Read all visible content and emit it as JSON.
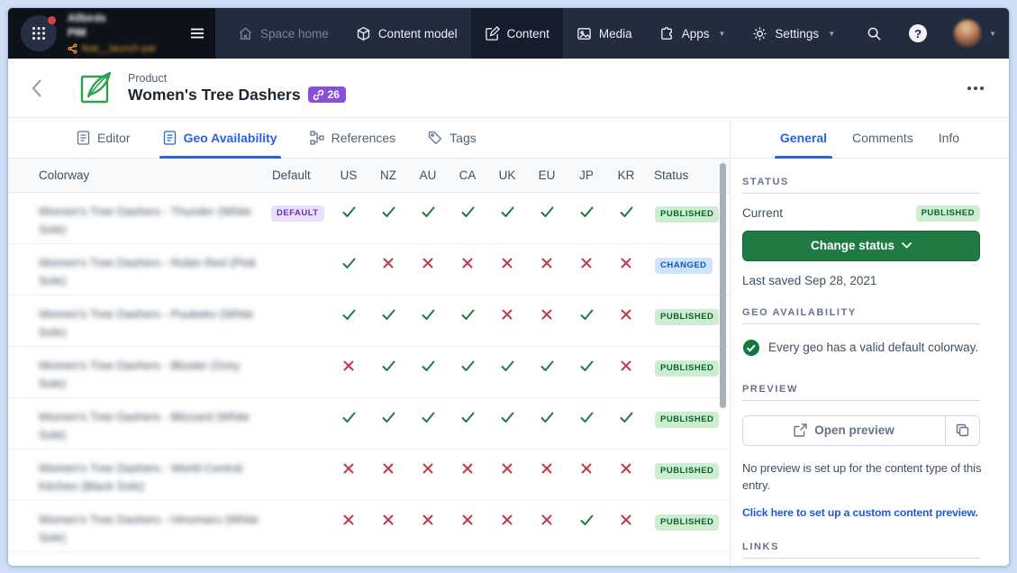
{
  "nav": {
    "space_name_line1": "Allbirds",
    "space_name_line2": "PIM",
    "branch": "feat__launch-par",
    "items": [
      {
        "label": "Space home"
      },
      {
        "label": "Content model"
      },
      {
        "label": "Content"
      },
      {
        "label": "Media"
      },
      {
        "label": "Apps"
      },
      {
        "label": "Settings"
      }
    ]
  },
  "header": {
    "content_type": "Product",
    "title": "Women's Tree Dashers",
    "link_count": "26"
  },
  "tabs": [
    {
      "label": "Editor"
    },
    {
      "label": "Geo Availability"
    },
    {
      "label": "References"
    },
    {
      "label": "Tags"
    }
  ],
  "table": {
    "columns": {
      "colorway": "Colorway",
      "default": "Default",
      "status": "Status"
    },
    "geo_columns": [
      "US",
      "NZ",
      "AU",
      "CA",
      "UK",
      "EU",
      "JP",
      "KR"
    ],
    "default_badge": "DEFAULT",
    "rows": [
      {
        "name": "Women's Tree Dashers - Thunder (White Sole)",
        "default": true,
        "geo": [
          1,
          1,
          1,
          1,
          1,
          1,
          1,
          1
        ],
        "status": "PUBLISHED"
      },
      {
        "name": "Women's Tree Dashers - Robin Red (Pink Sole)",
        "default": false,
        "geo": [
          1,
          0,
          0,
          0,
          0,
          0,
          0,
          0
        ],
        "status": "CHANGED"
      },
      {
        "name": "Women's Tree Dashers - Puukeko (White Sole)",
        "default": false,
        "geo": [
          1,
          1,
          1,
          1,
          0,
          0,
          1,
          0
        ],
        "status": "PUBLISHED"
      },
      {
        "name": "Women's Tree Dashers - Bluster (Grey Sole)",
        "default": false,
        "geo": [
          0,
          1,
          1,
          1,
          1,
          1,
          1,
          0
        ],
        "status": "PUBLISHED"
      },
      {
        "name": "Women's Tree Dashers - Blizzard (White Sole)",
        "default": false,
        "geo": [
          1,
          1,
          1,
          1,
          1,
          1,
          1,
          1
        ],
        "status": "PUBLISHED"
      },
      {
        "name": "Women's Tree Dashers - World Central Kitchen (Black Sole)",
        "default": false,
        "geo": [
          0,
          0,
          0,
          0,
          0,
          0,
          0,
          0
        ],
        "status": "PUBLISHED"
      },
      {
        "name": "Women's Tree Dashers - Hinomaru (White Sole)",
        "default": false,
        "geo": [
          0,
          0,
          0,
          0,
          0,
          0,
          1,
          0
        ],
        "status": "PUBLISHED"
      }
    ]
  },
  "sidebar": {
    "tabs": [
      {
        "label": "General"
      },
      {
        "label": "Comments"
      },
      {
        "label": "Info"
      }
    ],
    "status_section": {
      "heading": "STATUS",
      "current_label": "Current",
      "current_value": "PUBLISHED",
      "change_button": "Change status",
      "last_saved": "Last saved Sep 28, 2021"
    },
    "geo_section": {
      "heading": "GEO AVAILABILITY",
      "message": "Every geo has a valid default colorway."
    },
    "preview_section": {
      "heading": "PREVIEW",
      "open_button": "Open preview",
      "no_preview_text": "No preview is set up for the content type of this entry.",
      "link_text": "Click here to set up a custom content preview."
    },
    "links_section": {
      "heading": "LINKS"
    }
  },
  "colors": {
    "nav_bg": "#232b3e",
    "nav_active_bg": "#161d2d",
    "accent_blue": "#2b62d9",
    "green_button": "#207a43",
    "published_badge_bg": "#cdecd0",
    "published_badge_text": "#04652f",
    "changed_badge_bg": "#cee4fd",
    "changed_badge_text": "#0a56c4",
    "default_badge_bg": "#eadffc",
    "default_badge_text": "#6330b4",
    "link_badge_bg": "#8a4fd7",
    "check_green": "#1d7a45",
    "cross_red": "#c03a4b"
  }
}
